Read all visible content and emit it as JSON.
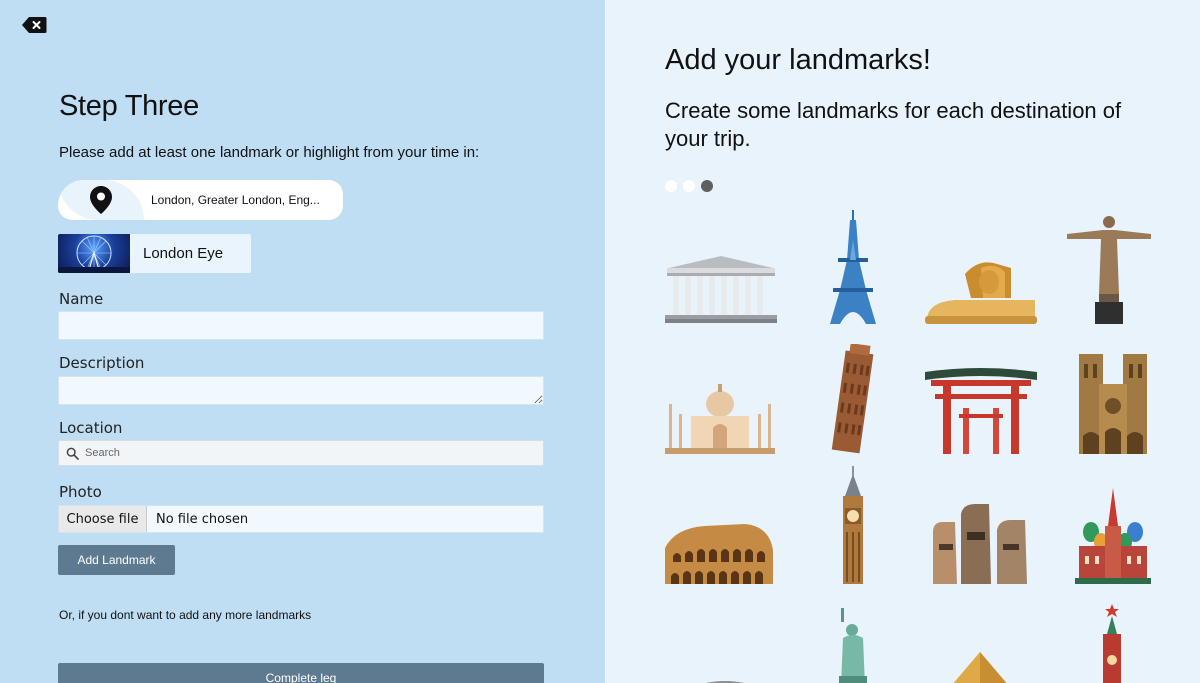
{
  "left": {
    "close_icon": "backspace-close-icon",
    "step_title": "Step Three",
    "intro": "Please add at least one landmark or highlight from your time in:",
    "destination": "London, Greater London, Eng...",
    "landmark_card": {
      "name": "London Eye"
    },
    "fields": {
      "name_label": "Name",
      "description_label": "Description",
      "location_label": "Location",
      "search_placeholder": "Search",
      "photo_label": "Photo",
      "choose_file": "Choose file",
      "no_file": "No file chosen"
    },
    "add_button": "Add Landmark",
    "or_text": "Or, if you dont want to add any more landmarks",
    "complete_button": "Complete leg"
  },
  "right": {
    "title": "Add your landmarks!",
    "subtitle": "Create some landmarks for each destination of your trip.",
    "dots": [
      {
        "active": false
      },
      {
        "active": false
      },
      {
        "active": true
      }
    ],
    "illustrations": [
      "parthenon",
      "eiffel-tower",
      "sphinx",
      "christ-the-redeemer",
      "taj-mahal",
      "leaning-tower-of-pisa",
      "torii-gate",
      "notre-dame",
      "colosseum",
      "big-ben",
      "moai-statues",
      "st-basils-cathedral",
      "stadium",
      "statue-of-liberty",
      "pyramid",
      "kremlin-tower"
    ]
  },
  "colors": {
    "left_bg": "#bfdef4",
    "right_bg": "#e9f3fb",
    "button": "#5e7a90",
    "dot_active": "#5f5f5f"
  }
}
